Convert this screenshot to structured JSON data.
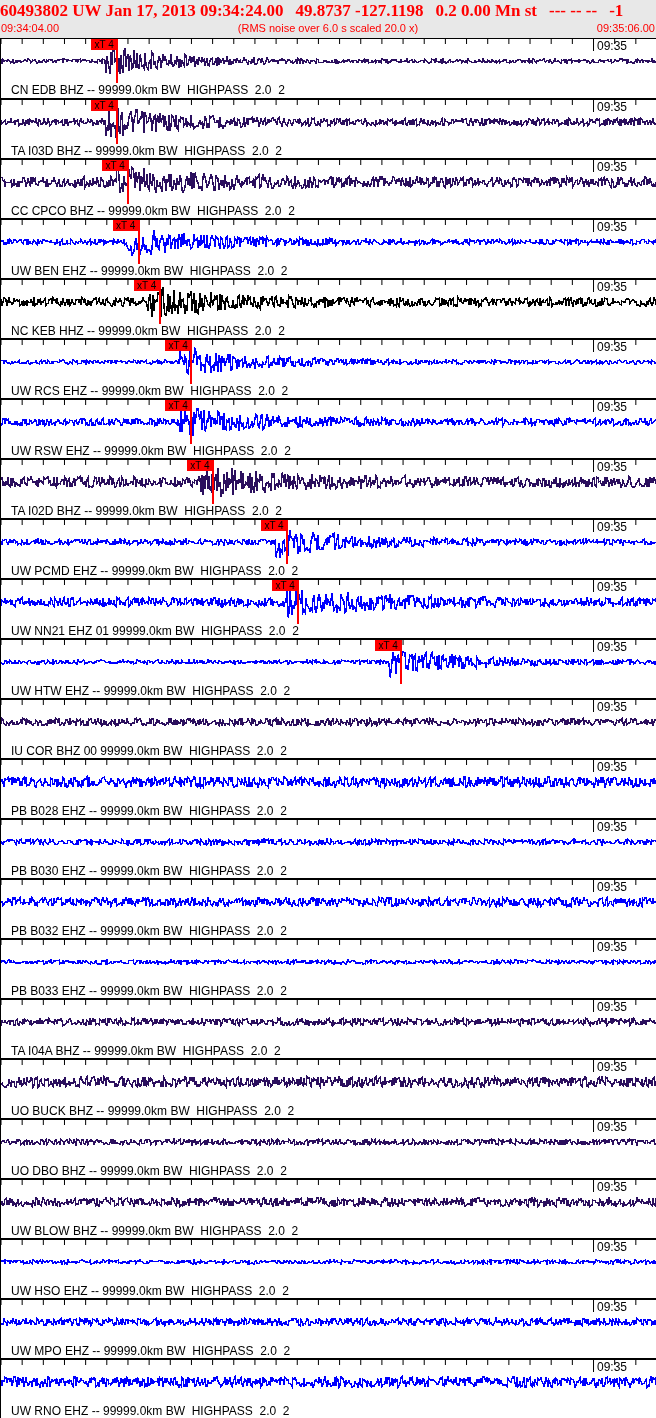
{
  "header": {
    "title_parts": [
      "60493802 UW Jan 17, 2013 09:34:24.00",
      "49.8737 -127.1198",
      "0.2 0.00 Mn st",
      "--- -- --",
      "-1"
    ],
    "start_time": "09:34:04.00",
    "note": "(RMS noise over 6.0 s scaled 20.0 x)",
    "end_time": "09:35:06.00"
  },
  "traces": [
    {
      "label": "CN EDB BHZ -- 99999.0km BW  HIGHPASS  2.0  2",
      "time_mark": "09:35",
      "color": "#2b0f5e",
      "pick": {
        "label": "xT 4",
        "level": 0.177
      }
    },
    {
      "label": "TA I03D BHZ -- 99999.0km BW  HIGHPASS  2.0  2",
      "time_mark": "09:35",
      "color": "#2b0f5e",
      "pick": {
        "label": "xT 4",
        "level": 0.177
      }
    },
    {
      "label": "CC CPCO BHZ -- 99999.0km BW  HIGHPASS  2.0  2",
      "time_mark": "09:35",
      "color": "#2b0f5e",
      "pick": {
        "label": "xT 4",
        "level": 0.194
      }
    },
    {
      "label": "UW BEN EHZ -- 99999.0km BW  HIGHPASS  2.0  2",
      "time_mark": "09:35",
      "color": "#0000ff",
      "pick": {
        "label": "xT 4",
        "level": 0.21
      }
    },
    {
      "label": "NC KEB HHZ -- 99999.0km BW  HIGHPASS  2.0  2",
      "time_mark": "09:35",
      "color": "#000000",
      "pick": {
        "label": "xT 4",
        "level": 0.242
      }
    },
    {
      "label": "UW RCS EHZ -- 99999.0km BW  HIGHPASS  2.0  2",
      "time_mark": "09:35",
      "color": "#0000ff",
      "pick": {
        "label": "xT 4",
        "level": 0.29
      }
    },
    {
      "label": "UW RSW EHZ -- 99999.0km BW  HIGHPASS  2.0  2",
      "time_mark": "09:35",
      "color": "#0000ff",
      "pick": {
        "label": "xT 4",
        "level": 0.29
      }
    },
    {
      "label": "TA I02D BHZ -- 99999.0km BW  HIGHPASS  2.0  2",
      "time_mark": "09:35",
      "color": "#2b0f5e",
      "pick": {
        "label": "xT 4",
        "level": 0.323
      }
    },
    {
      "label": "UW PCMD EHZ -- 99999.0km BW  HIGHPASS  2.0  2",
      "time_mark": "09:35",
      "color": "#0000ff",
      "pick": {
        "label": "xT 4",
        "level": 0.436
      }
    },
    {
      "label": "UW NN21 EHZ 01 99999.0km BW  HIGHPASS  2.0  2",
      "time_mark": "09:35",
      "color": "#0000ff",
      "pick": {
        "label": "xT 4",
        "level": 0.453
      }
    },
    {
      "label": "UW HTW EHZ -- 99999.0km BW  HIGHPASS  2.0  2",
      "time_mark": "09:35",
      "color": "#0000ff",
      "pick": {
        "label": "xT 4",
        "level": 0.61
      }
    },
    {
      "label": "IU COR BHZ 00 99999.0km BW  HIGHPASS  2.0  2",
      "time_mark": "09:35",
      "color": "#2b0f5e"
    },
    {
      "label": "PB B028 EHZ -- 99999.0km BW  HIGHPASS  2.0  2",
      "time_mark": "09:35",
      "color": "#0000ff"
    },
    {
      "label": "PB B030 EHZ -- 99999.0km BW  HIGHPASS  2.0  2",
      "time_mark": "09:35",
      "color": "#0000ff"
    },
    {
      "label": "PB B032 EHZ -- 99999.0km BW  HIGHPASS  2.0  2",
      "time_mark": "09:35",
      "color": "#0000ff"
    },
    {
      "label": "PB B033 EHZ -- 99999.0km BW  HIGHPASS  2.0  2",
      "time_mark": "09:35",
      "color": "#0000ff"
    },
    {
      "label": "TA I04A BHZ -- 99999.0km BW  HIGHPASS  2.0  2",
      "time_mark": "09:35",
      "color": "#2b0f5e"
    },
    {
      "label": "UO BUCK BHZ -- 99999.0km BW  HIGHPASS  2.0  2",
      "time_mark": "09:35",
      "color": "#2b0f5e"
    },
    {
      "label": "UO DBO BHZ -- 99999.0km BW  HIGHPASS  2.0  2",
      "time_mark": "09:35",
      "color": "#2b0f5e"
    },
    {
      "label": "UW BLOW BHZ -- 99999.0km BW  HIGHPASS  2.0  2",
      "time_mark": "09:35",
      "color": "#2b0f5e"
    },
    {
      "label": "UW HSO EHZ -- 99999.0km BW  HIGHPASS  2.0  2",
      "time_mark": "09:35",
      "color": "#0000ff"
    },
    {
      "label": "UW MPO EHZ -- 99999.0km BW  HIGHPASS  2.0  2",
      "time_mark": "09:35",
      "color": "#0000ff"
    },
    {
      "label": "UW RNO EHZ -- 99999.0km BW  HIGHPASS  2.0  2",
      "time_mark": "09:35",
      "color": "#0000ff"
    }
  ]
}
